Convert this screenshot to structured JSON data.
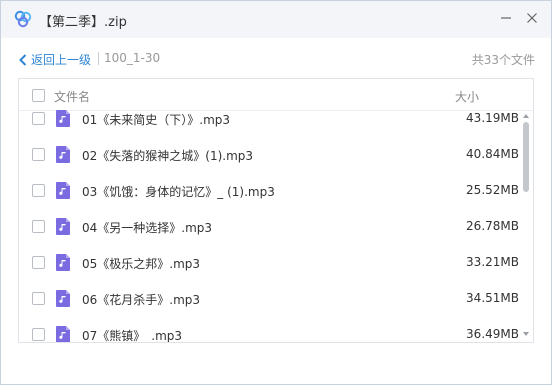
{
  "window": {
    "title": "【第二季】.zip",
    "app_icon": "baidu-netdisk-cloud-icon",
    "minimize_icon": "minimize-icon",
    "close_icon": "close-icon"
  },
  "nav": {
    "back_label": "返回上一级",
    "current_folder": "100_1-30",
    "total_label": "共33个文件"
  },
  "list": {
    "header": {
      "name_label": "文件名",
      "size_label": "大小"
    },
    "file_icon": "audio-file-icon",
    "accent": "#7a6be0",
    "items": [
      {
        "name": "01《未来简史（下）》.mp3",
        "size": "43.19MB"
      },
      {
        "name": "02《失落的猴神之城》(1).mp3",
        "size": "40.84MB"
      },
      {
        "name": "03《饥饿：身体的记忆》_ (1).mp3",
        "size": "25.52MB"
      },
      {
        "name": "04《另一种选择》.mp3",
        "size": "26.78MB"
      },
      {
        "name": "05《极乐之邦》.mp3",
        "size": "33.21MB"
      },
      {
        "name": "06《花月杀手》.mp3",
        "size": "34.51MB"
      },
      {
        "name": "07《熊镇》_.mp3",
        "size": "36.49MB"
      }
    ]
  },
  "colors": {
    "link_blue": "#2f86d6",
    "titlebar_bg": "#f3f5f8"
  }
}
